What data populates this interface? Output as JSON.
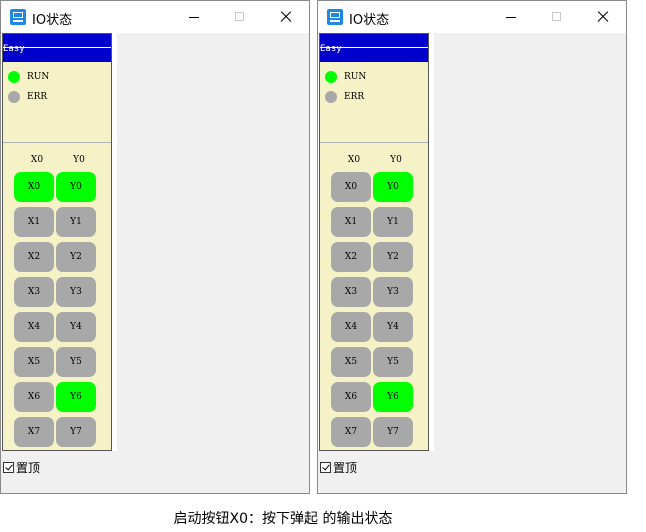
{
  "colors": {
    "on": "#00ff00",
    "off": "#a8a8a8",
    "run_on": "#00ff00",
    "err_off": "#a8a8a8",
    "easy_bar": "#0000cc"
  },
  "windows": [
    {
      "title": "IO状态",
      "app_icon": "app-logo-icon",
      "easy_label": "Easy",
      "status": [
        {
          "label": "RUN",
          "state": "on"
        },
        {
          "label": "ERR",
          "state": "off"
        }
      ],
      "headers": {
        "inputs": "X0",
        "outputs": "Y0"
      },
      "inputs": [
        {
          "label": "X0",
          "state": "on"
        },
        {
          "label": "X1",
          "state": "off"
        },
        {
          "label": "X2",
          "state": "off"
        },
        {
          "label": "X3",
          "state": "off"
        },
        {
          "label": "X4",
          "state": "off"
        },
        {
          "label": "X5",
          "state": "off"
        },
        {
          "label": "X6",
          "state": "off"
        },
        {
          "label": "X7",
          "state": "off"
        }
      ],
      "outputs": [
        {
          "label": "Y0",
          "state": "on"
        },
        {
          "label": "Y1",
          "state": "off"
        },
        {
          "label": "Y2",
          "state": "off"
        },
        {
          "label": "Y3",
          "state": "off"
        },
        {
          "label": "Y4",
          "state": "off"
        },
        {
          "label": "Y5",
          "state": "off"
        },
        {
          "label": "Y6",
          "state": "on"
        },
        {
          "label": "Y7",
          "state": "off"
        }
      ],
      "pin_top": {
        "label": "置顶",
        "checked": true
      }
    },
    {
      "title": "IO状态",
      "app_icon": "app-logo-icon",
      "easy_label": "Easy",
      "status": [
        {
          "label": "RUN",
          "state": "on"
        },
        {
          "label": "ERR",
          "state": "off"
        }
      ],
      "headers": {
        "inputs": "X0",
        "outputs": "Y0"
      },
      "inputs": [
        {
          "label": "X0",
          "state": "off"
        },
        {
          "label": "X1",
          "state": "off"
        },
        {
          "label": "X2",
          "state": "off"
        },
        {
          "label": "X3",
          "state": "off"
        },
        {
          "label": "X4",
          "state": "off"
        },
        {
          "label": "X5",
          "state": "off"
        },
        {
          "label": "X6",
          "state": "off"
        },
        {
          "label": "X7",
          "state": "off"
        }
      ],
      "outputs": [
        {
          "label": "Y0",
          "state": "on"
        },
        {
          "label": "Y1",
          "state": "off"
        },
        {
          "label": "Y2",
          "state": "off"
        },
        {
          "label": "Y3",
          "state": "off"
        },
        {
          "label": "Y4",
          "state": "off"
        },
        {
          "label": "Y5",
          "state": "off"
        },
        {
          "label": "Y6",
          "state": "on"
        },
        {
          "label": "Y7",
          "state": "off"
        }
      ],
      "pin_top": {
        "label": "置顶",
        "checked": true
      }
    }
  ],
  "caption": "启动按钮X0：按下弹起 的输出状态"
}
